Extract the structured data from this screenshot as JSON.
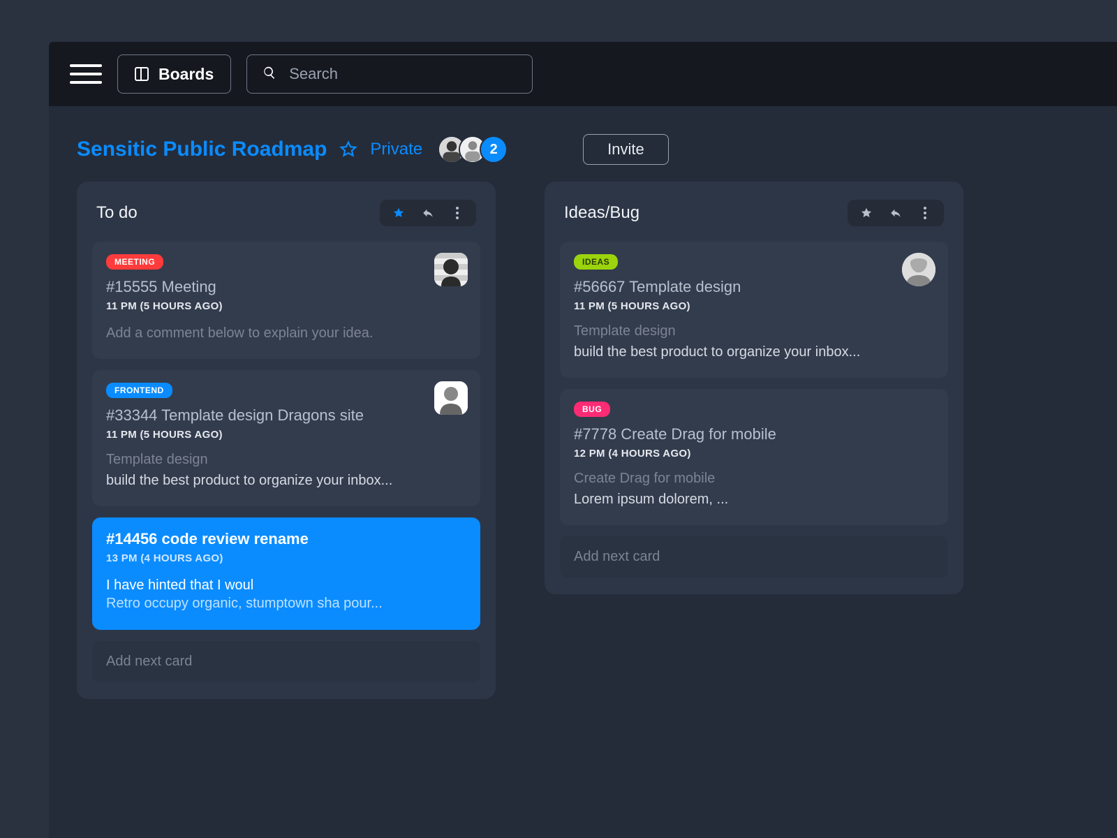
{
  "topbar": {
    "boards_label": "Boards",
    "search_placeholder": "Search"
  },
  "board": {
    "title": "Sensitic Public Roadmap",
    "privacy": "Private",
    "avatar_extra": "2",
    "invite_label": "Invite"
  },
  "columns": [
    {
      "title": "To do",
      "star_active": true,
      "cards": [
        {
          "tag": "MEETING",
          "tag_color": "red",
          "title": "#15555 Meeting",
          "time": "11 PM (5 HOURS AGO)",
          "subtitle": "",
          "body": "Add a comment below to explain your idea.",
          "avatar": "dark-cap",
          "highlight": false
        },
        {
          "tag": "FRONTEND",
          "tag_color": "blue",
          "title": "#33344 Template design Dragons site",
          "time": "11 PM (5 HOURS AGO)",
          "subtitle": "Template design",
          "body": "build the best product to organize your inbox...",
          "avatar": "light-guy",
          "highlight": false
        },
        {
          "tag": "",
          "tag_color": "",
          "title": "#14456 code review rename",
          "time": "13 PM (4 HOURS AGO)",
          "subtitle": "",
          "body": "I have hinted that I woul",
          "body2": "Retro occupy organic, stumptown sha pour...",
          "avatar": "",
          "highlight": true
        }
      ],
      "add_label": "Add next card"
    },
    {
      "title": "Ideas/Bug",
      "star_active": false,
      "cards": [
        {
          "tag": "IDEAS",
          "tag_color": "green",
          "title": "#56667 Template design",
          "time": "11 PM (5 HOURS AGO)",
          "subtitle": "Template design",
          "body": "build the best product to organize your inbox...",
          "avatar": "woman",
          "highlight": false
        },
        {
          "tag": "BUG",
          "tag_color": "pink",
          "title": "#7778 Create Drag for mobile",
          "time": "12 PM (4 HOURS AGO)",
          "subtitle": "Create Drag for mobile",
          "body": "Lorem ipsum dolorem, ...",
          "avatar": "",
          "highlight": false
        }
      ],
      "add_label": "Add next card"
    }
  ]
}
